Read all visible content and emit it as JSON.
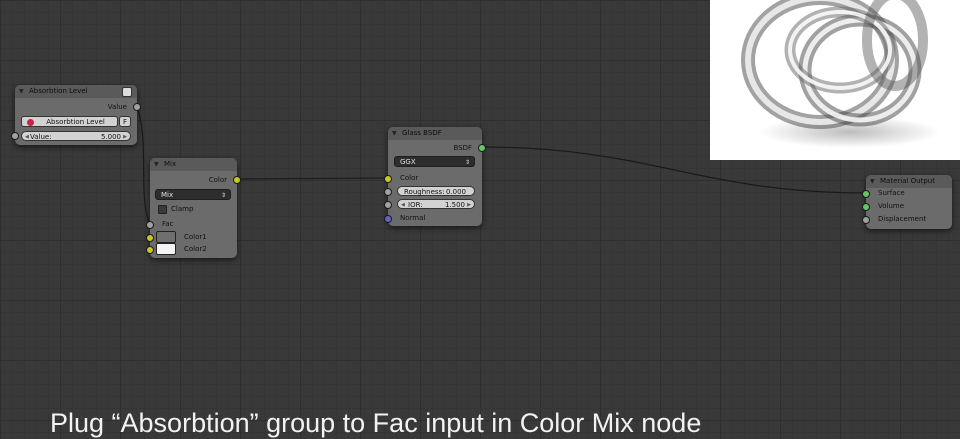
{
  "nodes": {
    "absorption": {
      "title": "Absorbtion Level",
      "output_label": "Value",
      "group_name": "Absorbtion Level",
      "fake_user": "F",
      "value_label": "Value:",
      "value": "5.000"
    },
    "mix": {
      "title": "Mix",
      "output_label": "Color",
      "blend_mode": "Mix",
      "clamp_label": "Clamp",
      "fac_label": "Fac",
      "color1_label": "Color1",
      "color2_label": "Color2",
      "color1": "#6f6f6f",
      "color2": "#f4f4f4"
    },
    "glass": {
      "title": "Glass BSDF",
      "output_label": "BSDF",
      "distribution": "GGX",
      "color_label": "Color",
      "roughness_label": "Roughness:",
      "roughness": "0.000",
      "ior_label": "IOR:",
      "ior": "1.500",
      "normal_label": "Normal"
    },
    "output": {
      "title": "Material Output",
      "surface_label": "Surface",
      "volume_label": "Volume",
      "displacement_label": "Displacement"
    }
  },
  "caption": "Plug “Absorbtion” group to Fac input in Color Mix node",
  "colors": {
    "socket_gray": "#a1a1a1",
    "socket_yellow": "#c7c729",
    "socket_green": "#63c763",
    "socket_blue": "#6363c7"
  }
}
